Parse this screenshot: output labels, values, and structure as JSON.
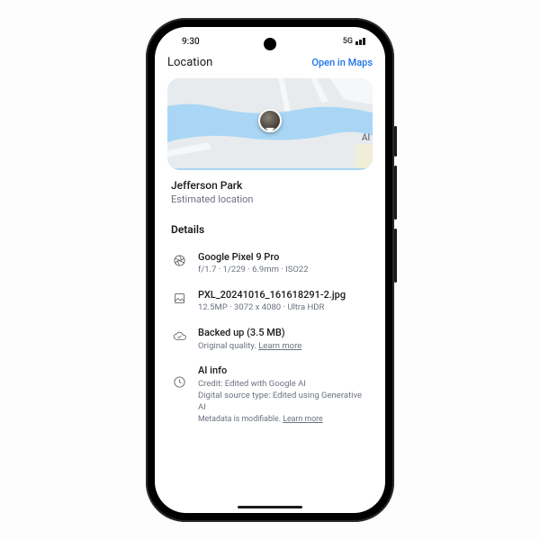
{
  "status": {
    "time": "9:30",
    "net": "5G"
  },
  "header": {
    "title": "Location",
    "action": "Open in Maps"
  },
  "map": {
    "nearby_label": "Al"
  },
  "location": {
    "name": "Jefferson Park",
    "sub": "Estimated location"
  },
  "details_heading": "Details",
  "rows": {
    "camera": {
      "title": "Google Pixel 9 Pro",
      "sub": "f/1.7  ·  1/229  ·  6.9mm  ·  ISO22"
    },
    "file": {
      "title": "PXL_20241016_161618291-2.jpg",
      "sub": "12.5MP  ·  3072 x 4080  · Ultra HDR"
    },
    "backup": {
      "title": "Backed up (3.5 MB)",
      "sub_prefix": "Original quality. ",
      "learn": "Learn more"
    },
    "ai": {
      "title": "AI info",
      "line1": "Credit: Edited with Google AI",
      "line2": "Digital source type: Edited using Generative AI",
      "meta_prefix": "Metadata is modifiable. ",
      "learn": "Learn more"
    }
  }
}
